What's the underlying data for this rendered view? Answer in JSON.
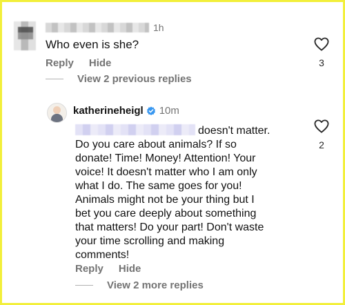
{
  "comment1": {
    "time": "1h",
    "text": "Who even is she?",
    "reply_label": "Reply",
    "hide_label": "Hide",
    "view_replies": "View 2 previous replies",
    "likes": "3"
  },
  "comment2": {
    "username": "katherineheigl",
    "time": "10m",
    "body_lines": [
      "doesn't matter.",
      "Do you care about animals? If so",
      "donate! Time! Money! Attention! Your",
      "voice! It doesn't matter who I am only",
      "what I do. The same goes for you!",
      "Animals might not be your thing but I",
      "bet you care deeply about something",
      "that matters! Do your part! Don't waste",
      "your time scrolling and making",
      "comments!"
    ],
    "reply_label": "Reply",
    "hide_label": "Hide",
    "view_replies": "View 2 more replies",
    "likes": "2"
  },
  "colors": {
    "border": "#f2ef3a",
    "secondary_text": "#737373",
    "verified_blue": "#3897f0"
  },
  "icons": {
    "like": "heart-outline-icon",
    "verified": "verified-badge-icon"
  }
}
